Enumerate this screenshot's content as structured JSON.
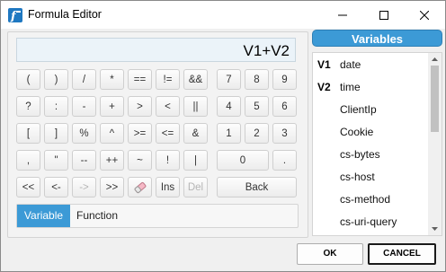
{
  "window": {
    "title": "Formula Editor"
  },
  "display": {
    "value": "V1+V2"
  },
  "keypad": {
    "rows": [
      [
        "(",
        ")",
        "/",
        "*",
        "==",
        "!=",
        "&&",
        "7",
        "8",
        "9"
      ],
      [
        "?",
        ":",
        "-",
        "+",
        ">",
        "<",
        "||",
        "4",
        "5",
        "6"
      ],
      [
        "[",
        "]",
        "%",
        "^",
        ">=",
        "<=",
        "&",
        "1",
        "2",
        "3"
      ],
      [
        ",",
        "\"",
        "--",
        "++",
        "~",
        "!",
        "|",
        "0",
        "."
      ],
      [
        "<<",
        "<-",
        "->",
        ">>",
        "eraser",
        "Ins",
        "Del",
        "Back"
      ]
    ],
    "disabled": [
      "->",
      "Del"
    ]
  },
  "modes": {
    "active": "Variable",
    "other": "Function"
  },
  "variables": {
    "header": "Variables",
    "items": [
      {
        "tag": "V1",
        "name": "date"
      },
      {
        "tag": "V2",
        "name": "time"
      },
      {
        "tag": "",
        "name": "ClientIp"
      },
      {
        "tag": "",
        "name": "Cookie"
      },
      {
        "tag": "",
        "name": "cs-bytes"
      },
      {
        "tag": "",
        "name": "cs-host"
      },
      {
        "tag": "",
        "name": "cs-method"
      },
      {
        "tag": "",
        "name": "cs-uri-query"
      }
    ]
  },
  "buttons": {
    "ok": "OK",
    "cancel": "CANCEL"
  },
  "colors": {
    "accent": "#3c9ad6",
    "display_bg": "#ebf3f9"
  },
  "icons": {
    "app": "formula-icon",
    "eraser": "eraser-icon"
  }
}
